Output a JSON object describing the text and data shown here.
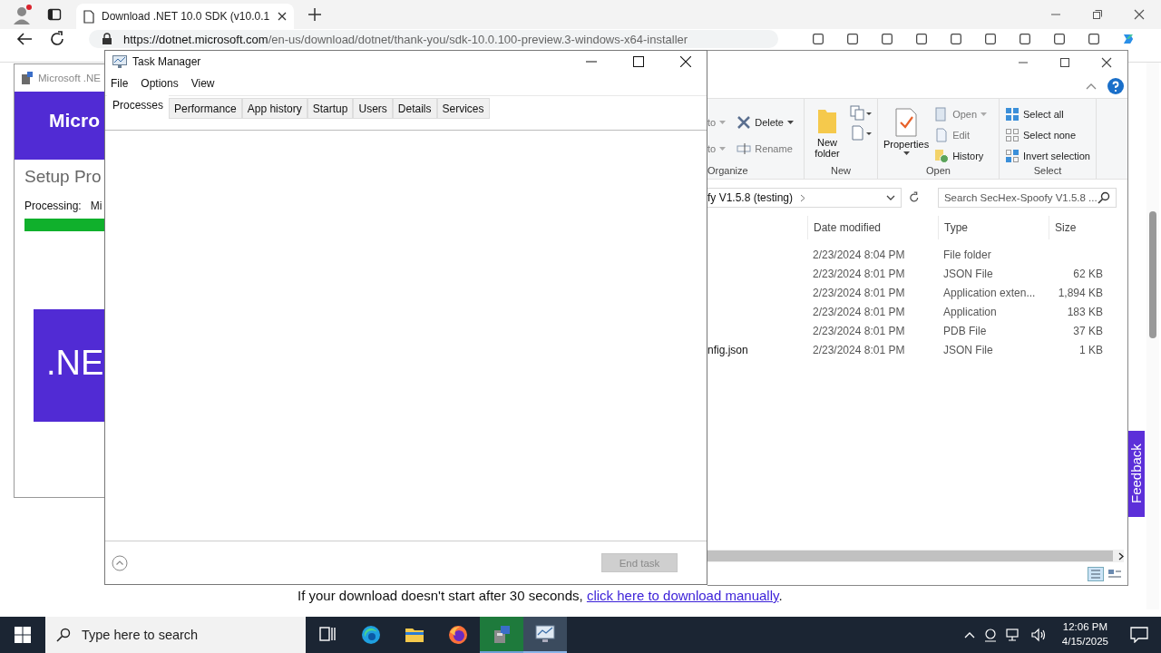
{
  "browser": {
    "tabs": [
      {
        "title": "Download .NET 10.0 SDK (v10.0.1",
        "selected": true
      }
    ],
    "url_host": "https://dotnet.microsoft.com",
    "url_path": "/en-us/download/dotnet/thank-you/sdk-10.0.100-preview.3-windows-x64-installer",
    "download_note": {
      "text": "If your download doesn't start after 30 seconds, ",
      "link": "click here to download manually",
      "tail": "."
    },
    "feedback": "Feedback"
  },
  "setup_window": {
    "title": "Microsoft .NE",
    "banner": "Micro",
    "heading": "Setup Pro",
    "processing_label": "Processing:",
    "processing_item": "Mi",
    "progress": {
      "level": 1
    },
    "logo": ".NE"
  },
  "task_manager": {
    "title": "Task Manager",
    "menus": [
      "File",
      "Options",
      "View"
    ],
    "tabs": [
      {
        "label": "Processes",
        "selected": true
      },
      {
        "label": "Performance",
        "selected": false
      },
      {
        "label": "App history",
        "selected": false
      },
      {
        "label": "Startup",
        "selected": false
      },
      {
        "label": "Users",
        "selected": false
      },
      {
        "label": "Details",
        "selected": false
      },
      {
        "label": "Services",
        "selected": false
      }
    ],
    "end_task": {
      "label": "End task",
      "disabled": true
    }
  },
  "explorer": {
    "ribbon": {
      "groups": [
        {
          "label": "Organize",
          "items": [
            {
              "kind": "cut",
              "label": "to"
            },
            {
              "kind": "cut",
              "label": "to"
            },
            {
              "kind": "delete",
              "label": "Delete"
            },
            {
              "kind": "rename",
              "label": "Rename"
            }
          ]
        },
        {
          "label": "New",
          "items": [
            {
              "kind": "newfolder",
              "label": "New folder"
            }
          ]
        },
        {
          "label": "Open",
          "items": [
            {
              "kind": "properties",
              "label": "Properties"
            },
            {
              "kind": "open",
              "label": "Open"
            },
            {
              "kind": "edit",
              "label": "Edit"
            },
            {
              "kind": "history",
              "label": "History"
            }
          ]
        },
        {
          "label": "Select",
          "items": [
            {
              "kind": "selectall",
              "label": "Select all"
            },
            {
              "kind": "selectnone",
              "label": "Select none"
            },
            {
              "kind": "invert",
              "label": "Invert selection"
            }
          ]
        }
      ]
    },
    "address": "fy V1.5.8 (testing)",
    "search_placeholder": "Search SecHex-Spoofy V1.5.8 ...",
    "columns": [
      "Date modified",
      "Type",
      "Size"
    ],
    "rows": [
      {
        "name": "",
        "date": "2/23/2024 8:04 PM",
        "type": "File folder",
        "size": ""
      },
      {
        "name": "",
        "date": "2/23/2024 8:01 PM",
        "type": "JSON File",
        "size": "62 KB"
      },
      {
        "name": "",
        "date": "2/23/2024 8:01 PM",
        "type": "Application exten...",
        "size": "1,894 KB"
      },
      {
        "name": "",
        "date": "2/23/2024 8:01 PM",
        "type": "Application",
        "size": "183 KB"
      },
      {
        "name": "",
        "date": "2/23/2024 8:01 PM",
        "type": "PDB File",
        "size": "37 KB"
      },
      {
        "name": "nfig.json",
        "date": "2/23/2024 8:01 PM",
        "type": "JSON File",
        "size": "1 KB"
      }
    ]
  },
  "taskbar": {
    "search_placeholder": "Type here to search",
    "apps": [
      {
        "kind": "taskview",
        "selected": false
      },
      {
        "kind": "edge",
        "selected": false
      },
      {
        "kind": "folder",
        "selected": false
      },
      {
        "kind": "firefox",
        "selected": false
      },
      {
        "kind": "installer",
        "selected": false
      },
      {
        "kind": "taskmgr",
        "selected": true
      }
    ],
    "time": "12:06 PM",
    "date": "4/15/2025"
  }
}
